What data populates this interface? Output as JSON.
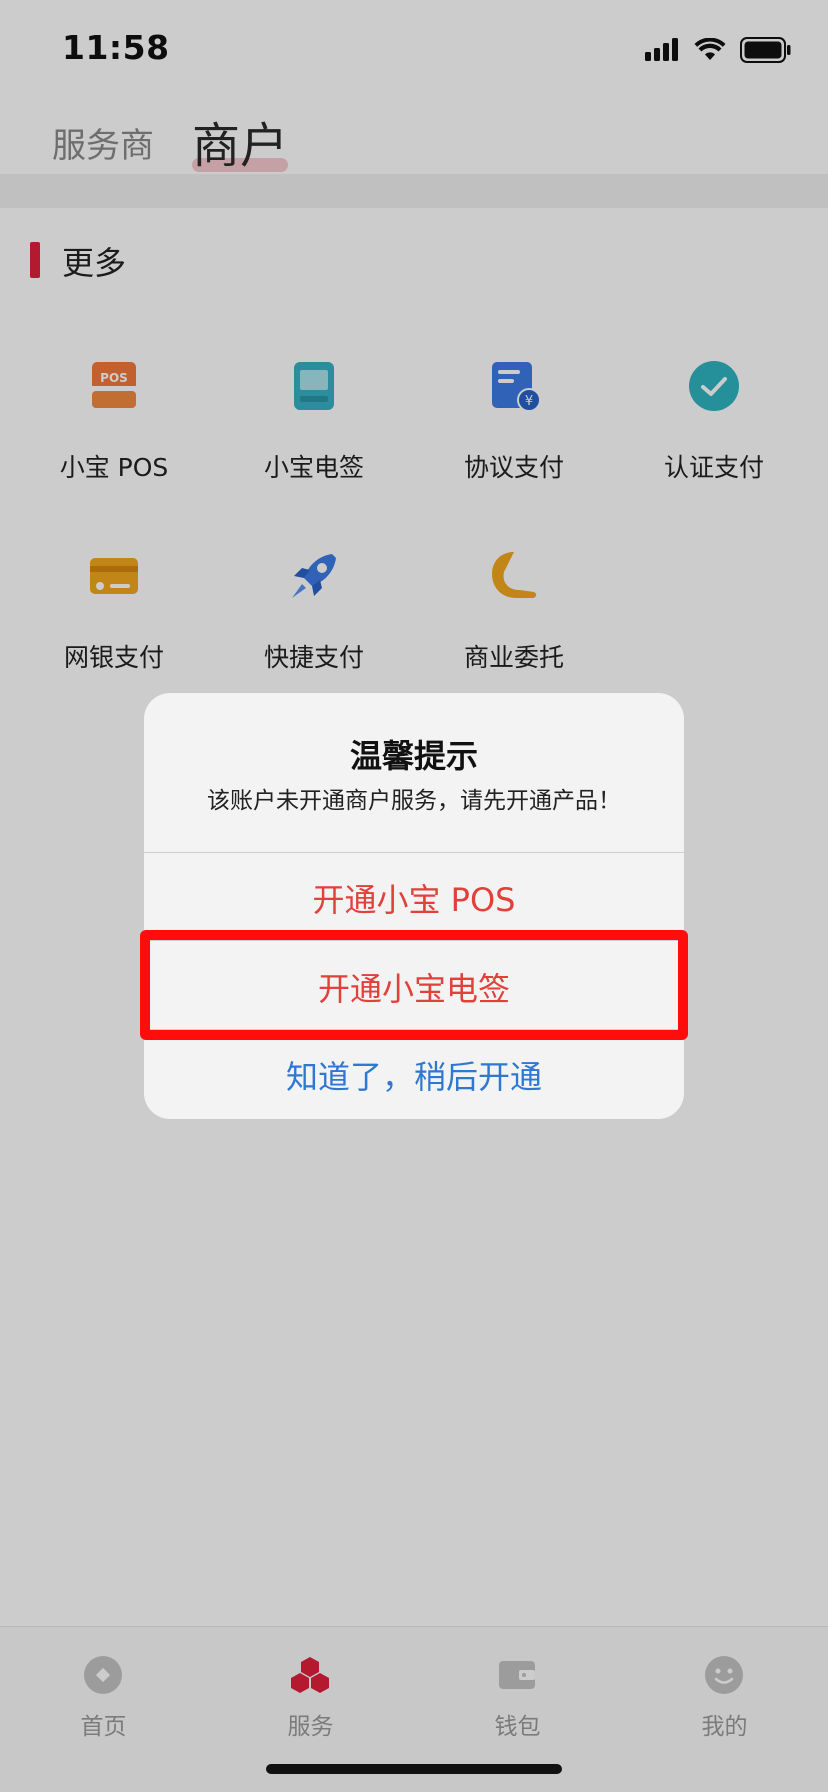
{
  "status_bar": {
    "time": "11:58"
  },
  "header": {
    "tab_inactive": "服务商",
    "tab_active": "商户"
  },
  "section": {
    "title": "更多"
  },
  "grid": {
    "items": [
      {
        "label": "小宝 POS",
        "icon": "pos-icon"
      },
      {
        "label": "小宝电签",
        "icon": "card-terminal-icon"
      },
      {
        "label": "协议支付",
        "icon": "document-yuan-icon"
      },
      {
        "label": "认证支付",
        "icon": "check-circle-icon"
      },
      {
        "label": "网银支付",
        "icon": "bank-card-icon"
      },
      {
        "label": "快捷支付",
        "icon": "rocket-icon"
      },
      {
        "label": "商业委托",
        "icon": "hand-e-icon"
      }
    ]
  },
  "dialog": {
    "title": "温馨提示",
    "message": "该账户未开通商户服务，请先开通产品！",
    "button_pos": "开通小宝 POS",
    "button_dianqian": "开通小宝电签",
    "button_later": "知道了，稍后开通"
  },
  "tabbar": {
    "items": [
      {
        "label": "首页",
        "icon": "home-icon"
      },
      {
        "label": "服务",
        "icon": "service-cubes-icon"
      },
      {
        "label": "钱包",
        "icon": "wallet-icon"
      },
      {
        "label": "我的",
        "icon": "smiley-icon"
      }
    ]
  },
  "colors": {
    "accent_red": "#e0213d",
    "dialog_red": "#e0413a",
    "dialog_blue": "#2e78d2",
    "highlight": "#ff0d0d"
  }
}
